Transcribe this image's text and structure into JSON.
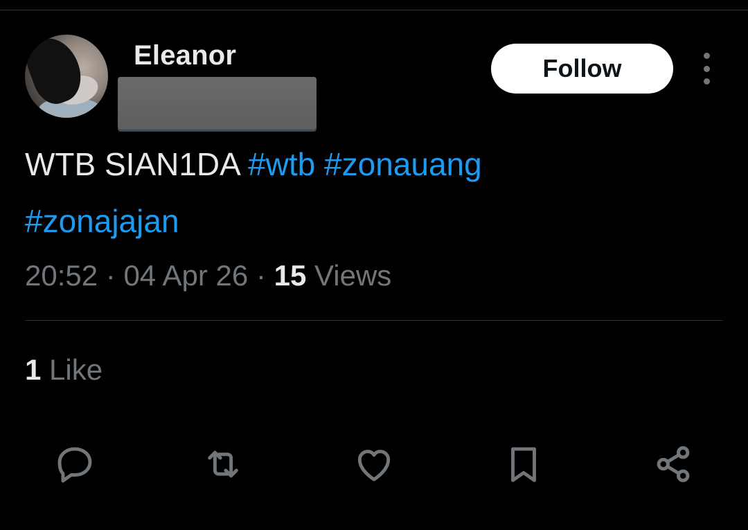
{
  "post": {
    "author_name": "Eleanor",
    "follow_label": "Follow",
    "text_plain": "WTB SIAN1DA ",
    "hashtags": [
      "#wtb",
      "#zonauang",
      "#zonajajan"
    ],
    "time": "20:52",
    "date": "04 Apr 26",
    "views_count": "15",
    "views_label": "Views",
    "separator": "·",
    "likes_count": "1",
    "likes_label": "Like"
  },
  "actions": {
    "icons": [
      "reply-icon",
      "repost-icon",
      "like-icon",
      "bookmark-icon",
      "share-icon"
    ]
  },
  "colors": {
    "background": "#000000",
    "text": "#e7e9ea",
    "muted": "#71767b",
    "link": "#1d9bf0",
    "follow_bg": "#ffffff"
  }
}
